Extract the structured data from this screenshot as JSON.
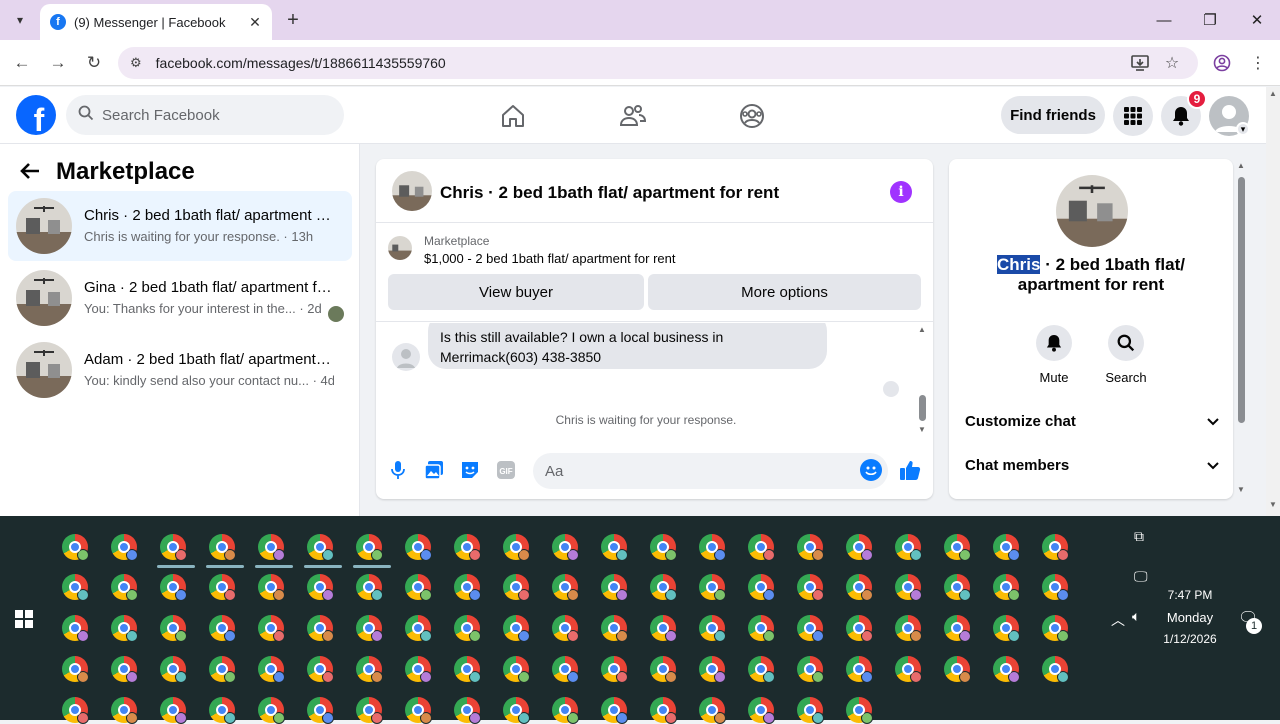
{
  "browser": {
    "tab_title": "(9) Messenger | Facebook",
    "url": "facebook.com/messages/t/1886611435559760"
  },
  "fb": {
    "search_placeholder": "Search Facebook",
    "find_friends": "Find friends",
    "notification_count": "9"
  },
  "left": {
    "title": "Marketplace",
    "conversations": [
      {
        "name": "Chris · 2 bed 1bath flat/ apartment for rent",
        "preview": "Chris is waiting for your response. · 13h",
        "active": true
      },
      {
        "name": "Gina · 2 bed 1bath flat/ apartment for rent",
        "preview": "You: Thanks for your interest in the... · 2d",
        "active": false
      },
      {
        "name": "Adam · 2 bed 1bath flat/ apartment for rent",
        "preview": "You: kindly send also your contact nu... · 4d",
        "active": false
      }
    ]
  },
  "chat": {
    "title": "Chris · 2 bed 1bath flat/ apartment for rent",
    "listing_category": "Marketplace",
    "listing_price": "$1,000 - 2 bed 1bath flat/ apartment for rent",
    "view_buyer": "View buyer",
    "more_options": "More options",
    "message_line1": "Is this still available?  I own a local business in",
    "message_line2": "Merrimack(603) 438-3850",
    "waiting": "Chris is waiting for your response.",
    "composer_placeholder": "Aa"
  },
  "right": {
    "title_name": "Chris",
    "title_rest": " · 2 bed 1bath flat/ apartment for rent",
    "mute": "Mute",
    "search": "Search",
    "customize": "Customize chat",
    "members": "Chat members"
  },
  "taskbar": {
    "time": "7:47 PM",
    "day": "Monday",
    "date": "1/12/2026",
    "notif_count": "1"
  },
  "colors": {
    "fb_blue": "#0866ff",
    "messenger_blue": "#0a7cff",
    "info_purple": "#a033ff",
    "badge_red": "#e41e3f"
  }
}
